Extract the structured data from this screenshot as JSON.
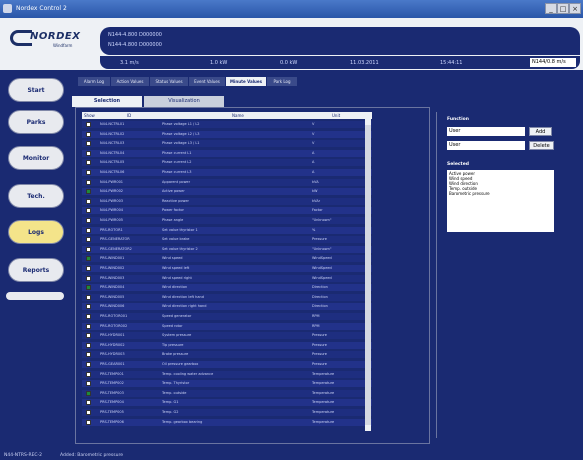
{
  "window": {
    "title": "Nordex Control 2"
  },
  "header": {
    "brand": "NORDEX",
    "brand_sub": "Windfarm",
    "info_rows": [
      "N144-4.800    D000000",
      "N144-4.800    D000000"
    ],
    "status": [
      "3.1 m/s",
      "1.0 kW",
      "0.0 kW",
      "11.03.2011",
      "15:44:11"
    ],
    "status_dropdown": "N144/0.8 m/s"
  },
  "sidebar": {
    "items": [
      {
        "label": "Start"
      },
      {
        "label": "Parks"
      },
      {
        "label": "Monitor"
      },
      {
        "label": "Tech."
      },
      {
        "label": "Logs"
      },
      {
        "label": "Reports"
      }
    ]
  },
  "subnav": {
    "tabs": [
      {
        "label": "Alarm Log"
      },
      {
        "label": "Action Values"
      },
      {
        "label": "Status Values"
      },
      {
        "label": "Event Values"
      },
      {
        "label": "Minute Values"
      },
      {
        "label": "Park Log"
      }
    ]
  },
  "view_tabs": [
    {
      "label": "Selection"
    },
    {
      "label": "Visualization"
    }
  ],
  "table": {
    "headers": {
      "show": "Show",
      "id": "ID",
      "name": "Name",
      "unit": "Unit"
    },
    "rows": [
      {
        "id": "N44-NCTRL01",
        "name": "Phase voltage L1 / L2",
        "unit": "V",
        "checked": false
      },
      {
        "id": "N44-NCTRL02",
        "name": "Phase voltage L2 / L3",
        "unit": "V",
        "checked": false
      },
      {
        "id": "N44-NCTRL03",
        "name": "Phase voltage L3 / L1",
        "unit": "V",
        "checked": false
      },
      {
        "id": "N44-NCTRL04",
        "name": "Phase current L1",
        "unit": "A",
        "checked": false
      },
      {
        "id": "N44-NCTRL05",
        "name": "Phase current L2",
        "unit": "A",
        "checked": false
      },
      {
        "id": "N44-NCTRL06",
        "name": "Phase current L3",
        "unit": "A",
        "checked": false
      },
      {
        "id": "N44-PWR001",
        "name": "Apparent power",
        "unit": "kVA",
        "checked": false
      },
      {
        "id": "N44-PWR002",
        "name": "Active power",
        "unit": "kW",
        "checked": true
      },
      {
        "id": "N44-PWR003",
        "name": "Reactive power",
        "unit": "kVAr",
        "checked": false
      },
      {
        "id": "N44-PWR004",
        "name": "Power factor",
        "unit": "Factor",
        "checked": false
      },
      {
        "id": "N44-PWR005",
        "name": "Phase angle",
        "unit": "\"Unknown\"",
        "checked": false
      },
      {
        "id": "PRS-ROTOR1",
        "name": "Set value thyristor 1",
        "unit": "%",
        "checked": false
      },
      {
        "id": "PRS-GENERATOR",
        "name": "Set value brake",
        "unit": "Pressure",
        "checked": false
      },
      {
        "id": "PRS-GENERATOR2",
        "name": "Set value thyristor 2",
        "unit": "\"Unknown\"",
        "checked": false
      },
      {
        "id": "PRS-WIND001",
        "name": "Wind speed",
        "unit": "WindSpeed",
        "checked": true
      },
      {
        "id": "PRS-WIND002",
        "name": "Wind speed left",
        "unit": "WindSpeed",
        "checked": false
      },
      {
        "id": "PRS-WIND003",
        "name": "Wind speed right",
        "unit": "WindSpeed",
        "checked": false
      },
      {
        "id": "PRS-WIND004",
        "name": "Wind direction",
        "unit": "Direction",
        "checked": true
      },
      {
        "id": "PRS-WIND005",
        "name": "Wind direction left hand",
        "unit": "Direction",
        "checked": false
      },
      {
        "id": "PRS-WIND006",
        "name": "Wind direction right hand",
        "unit": "Direction",
        "checked": false
      },
      {
        "id": "PRS-ROTOR001",
        "name": "Speed generator",
        "unit": "RPM",
        "checked": false
      },
      {
        "id": "PRS-ROTOR002",
        "name": "Speed rotor",
        "unit": "RPM",
        "checked": false
      },
      {
        "id": "PRS-HYDR001",
        "name": "System pressure",
        "unit": "Pressure",
        "checked": false
      },
      {
        "id": "PRS-HYDR002",
        "name": "Tip pressure",
        "unit": "Pressure",
        "checked": false
      },
      {
        "id": "PRS-HYDR003",
        "name": "Brake pressure",
        "unit": "Pressure",
        "checked": false
      },
      {
        "id": "PRS-GEAR001",
        "name": "Oil pressure gearbox",
        "unit": "Pressure",
        "checked": false
      },
      {
        "id": "PRS-TEMP001",
        "name": "Temp. cooling water advance",
        "unit": "Temperature",
        "checked": false
      },
      {
        "id": "PRS-TEMP002",
        "name": "Temp. Thyristor",
        "unit": "Temperature",
        "checked": false
      },
      {
        "id": "PRS-TEMP003",
        "name": "Temp. outside",
        "unit": "Temperature",
        "checked": true
      },
      {
        "id": "PRS-TEMP004",
        "name": "Temp. G1",
        "unit": "Temperature",
        "checked": false
      },
      {
        "id": "PRS-TEMP005",
        "name": "Temp. G2",
        "unit": "Temperature",
        "checked": false
      },
      {
        "id": "PRS-TEMP006",
        "name": "Temp. gearbox bearing",
        "unit": "Temperature",
        "checked": false
      }
    ]
  },
  "functions": {
    "title": "Function",
    "select1": "User",
    "add_label": "Add",
    "select2": "User",
    "delete_label": "Delete",
    "selected_title": "Selected",
    "selected_items": [
      "Active power",
      "Wind speed",
      "Wind direction",
      "Temp. outside",
      "Barometric pressure"
    ]
  },
  "footer": {
    "left": "N44-NTRS-REC-2",
    "msg": "Added: Barometric pressure"
  }
}
